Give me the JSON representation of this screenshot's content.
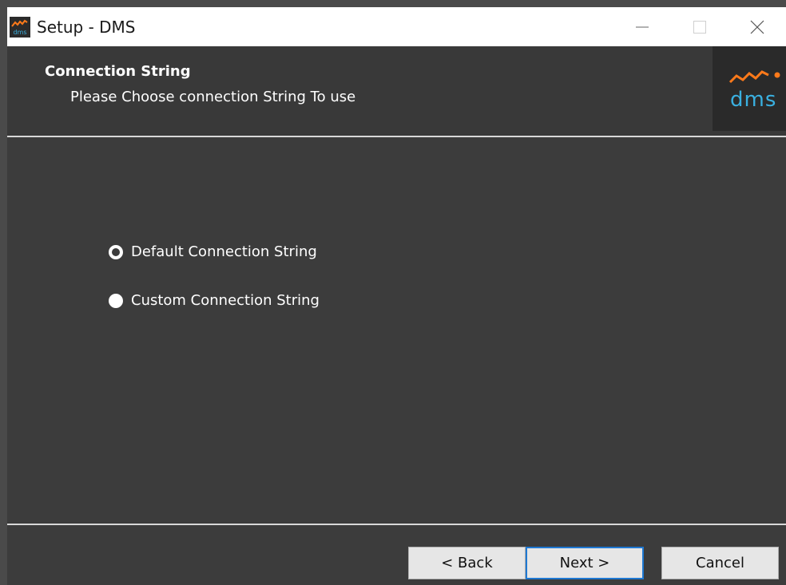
{
  "window": {
    "title": "Setup - DMS",
    "controls": [
      "minimize-icon",
      "maximize-icon",
      "close-icon"
    ]
  },
  "app_icon": {
    "text": "dms",
    "colors": [
      "#ff7a1a",
      "#3ab0e0"
    ]
  },
  "header": {
    "title": "Connection String",
    "subtitle": "Please Choose connection String To use",
    "logo_text": "dms"
  },
  "options": [
    {
      "label": "Default Connection String",
      "selected": true
    },
    {
      "label": "Custom Connection String",
      "selected": false
    }
  ],
  "buttons": {
    "back": "< Back",
    "next": "Next >",
    "cancel": "Cancel"
  },
  "colors": {
    "background": "#3c3c3c",
    "accent": "#1e78d2",
    "logo_orange": "#ff7a1a",
    "logo_blue": "#3ab0e0"
  }
}
